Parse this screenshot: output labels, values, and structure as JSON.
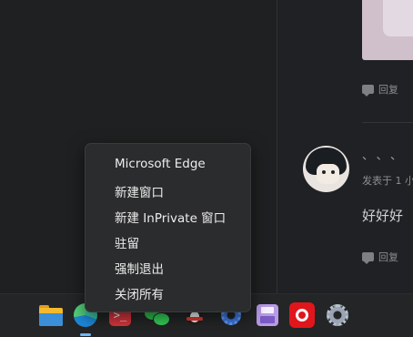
{
  "feed": {
    "reply_label": "回复",
    "post_dots": "、、、",
    "meta_text": "发表于 1 小",
    "comment_text": "好好好"
  },
  "context_menu": {
    "items": [
      "Microsoft Edge",
      "新建窗口",
      "新建 InPrivate 窗口",
      "驻留",
      "强制退出",
      "关闭所有"
    ]
  },
  "taskbar": {
    "icons": [
      "windows-start-icon",
      "file-explorer-icon",
      "edge-icon",
      "terminal-icon",
      "wechat-icon",
      "qq-icon",
      "gear-app-icon",
      "floppy-app-icon",
      "netease-music-icon",
      "settings-icon"
    ],
    "terminal_glyph": ">_"
  },
  "colors": {
    "accent": "#3aa6f4",
    "menu_bg": "#2b2c2d",
    "page_bg": "#1f2021"
  }
}
